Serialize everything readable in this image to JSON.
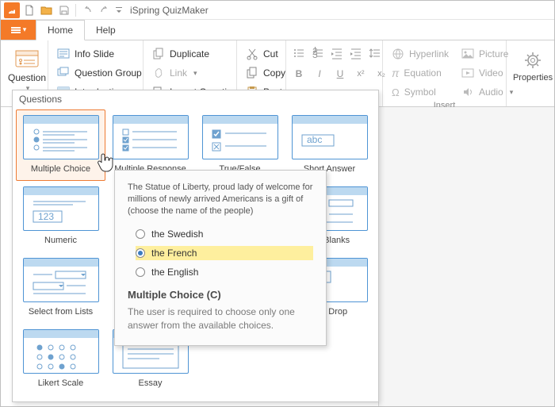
{
  "titlebar": {
    "app_title": "iSpring QuizMaker"
  },
  "tabs": {
    "home": "Home",
    "help": "Help"
  },
  "ribbon": {
    "question": {
      "label": "Question"
    },
    "slides": {
      "info_slide": "Info Slide",
      "question_group": "Question Group",
      "introduction": "Introduction"
    },
    "edit": {
      "duplicate": "Duplicate",
      "link": "Link",
      "import": "Import Questions"
    },
    "clipboard": {
      "cut": "Cut",
      "copy": "Copy",
      "paste": "Paste"
    },
    "insert": {
      "hyperlink": "Hyperlink",
      "equation": "Equation",
      "symbol": "Symbol",
      "picture": "Picture",
      "video": "Video",
      "audio": "Audio",
      "group_label": "Insert"
    },
    "properties": {
      "label": "Properties"
    }
  },
  "gallery": {
    "title": "Questions",
    "items": [
      {
        "label": "Multiple Choice"
      },
      {
        "label": "Multiple Response"
      },
      {
        "label": "True/False"
      },
      {
        "label": "Short Answer"
      },
      {
        "label": "Numeric"
      },
      {
        "label": "the Blanks"
      },
      {
        "label": "Select from Lists"
      },
      {
        "label": "and Drop"
      },
      {
        "label": "Likert Scale"
      },
      {
        "label": "Essay"
      }
    ]
  },
  "tooltip": {
    "question": "The Statue of Liberty, proud lady of welcome for millions of newly arrived Americans is a gift of (choose the name of the people)",
    "options": [
      "the Swedish",
      "the French",
      "the English"
    ],
    "title": "Multiple Choice (C)",
    "description": "The user is required to choose only one answer from the available choices."
  }
}
